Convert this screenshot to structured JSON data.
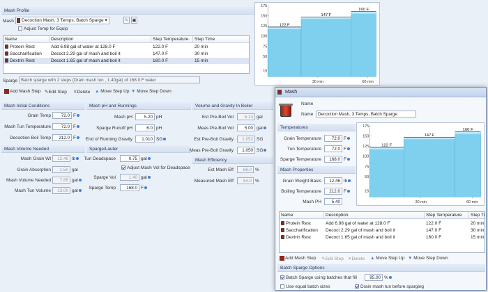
{
  "profile": {
    "section_title": "Mash Profile",
    "mash_label": "Mash",
    "mash_value": "Decoction Mash, 3 Temps, Batch Sparge",
    "adjust_temp_label": "Adjust Temp for Equip",
    "table_headers": [
      "Name",
      "Description",
      "Step Temperature",
      "Step Time"
    ],
    "rows": [
      {
        "name": "Protein Rest",
        "description": "Add 6.98 gal of water at 128.0 F",
        "temp": "122.0 F",
        "time": "20 min"
      },
      {
        "name": "Saccharification",
        "description": "Decoct 2.29 gal of mash and boil it",
        "temp": "147.0 F",
        "time": "30 min"
      },
      {
        "name": "Dextrin Rest",
        "description": "Decoct 1.65 gal of mash and boil it",
        "temp": "160.0 F",
        "time": "15 min"
      }
    ],
    "sparge_label": "Sparge",
    "sparge_value": "Batch sparge with 2 steps (Drain mash tun , 1.40gal) of 168.0 F water",
    "toolbar": {
      "add": "Add Mash Step",
      "edit": "Edit Step",
      "delete": "Delete",
      "up": "Move Step Up",
      "down": "Move Step Down"
    }
  },
  "initial": {
    "title": "Mash Initial Conditions",
    "grain_temp_label": "Grain Temp",
    "grain_temp": "72.0",
    "tun_temp_label": "Mash Tun Temperature",
    "tun_temp": "72.0",
    "boil_temp_label": "Decoction Boil Temp",
    "boil_temp": "212.0",
    "unit_f": "F"
  },
  "vol_needed": {
    "title": "Mash Volume Needed",
    "grain_wt_label": "Mash Grain Wt",
    "grain_wt": "12.46",
    "unit_lb": "lb",
    "absorb_label": "Grain Absorption",
    "absorb": "1.50",
    "unit_gal": "gal",
    "mash_vol_label": "Mash Volume Needed",
    "mash_vol": "7.85",
    "tun_vol_label": "Mash Tun Volume",
    "tun_vol": "13.00"
  },
  "ph": {
    "title": "Mash pH and Runnings",
    "mash_ph_label": "Mash pH",
    "mash_ph": "5.20",
    "unit_ph": "pH",
    "runoff_label": "Sparge Runoff pH",
    "runoff": "6.0",
    "gravity_label": "End of Running Gravity",
    "gravity": "1.010",
    "unit_sg": "SG"
  },
  "lauter": {
    "title": "Sparge/Lauter",
    "deadspace_label": "Tun Deadspace",
    "deadspace": "0.75",
    "unit_gal": "gal",
    "adjust_label": "Adjust Mash Vol for Deadspace",
    "sparge_vol_label": "Sparge Vol",
    "sparge_vol": "1.40",
    "sparge_temp_label": "Sparge Temp",
    "sparge_temp": "168.0",
    "unit_f": "F"
  },
  "boiler": {
    "title": "Volume and Gravity In Boiler",
    "est_vol_label": "Est Pre-Boil Vol",
    "est_vol": "6.13",
    "meas_vol_label": "Meas Pre-Boil Vol",
    "meas_vol": "5.00",
    "unit_gal": "gal",
    "est_grav_label": "Est Pre-Boil Gravity",
    "est_grav": "1.052",
    "meas_grav_label": "Meas Pre-Boil Gravity",
    "meas_grav": "1.050",
    "unit_sg": "SG"
  },
  "eff": {
    "title": "Mash Efficiency",
    "est_label": "Est Mash Eff",
    "est": "68.0",
    "meas_label": "Measured Mash Eff",
    "meas": "54.0",
    "unit": "%"
  },
  "chart_data": [
    {
      "type": "area",
      "y_ticks": [
        "15",
        "50",
        "75",
        "100",
        "125",
        "150",
        "175"
      ],
      "x_ticks": [
        "30 min",
        "60 min"
      ],
      "steps": [
        {
          "label": "122 F",
          "temp": 122,
          "start": 0,
          "end": 20
        },
        {
          "label": "147 F",
          "temp": 147,
          "start": 20,
          "end": 50
        },
        {
          "label": "160 F",
          "temp": 160,
          "start": 50,
          "end": 65
        }
      ]
    },
    {
      "type": "area",
      "y_ticks": [
        "15",
        "50",
        "75",
        "100",
        "125",
        "150",
        "175"
      ],
      "x_ticks": [
        "30 min",
        "60 min"
      ],
      "steps": [
        {
          "label": "122 F",
          "temp": 122,
          "start": 0,
          "end": 20
        },
        {
          "label": "147 F",
          "temp": 147,
          "start": 20,
          "end": 50
        },
        {
          "label": "160 F",
          "temp": 160,
          "start": 50,
          "end": 65
        }
      ]
    }
  ],
  "dialog": {
    "title": "Mash",
    "name_section": "Name",
    "name_label": "Name",
    "name_value": "Decoction Mash, 3 Temps, Batch Sparge",
    "temps_title": "Temperatures",
    "grain_temp_label": "Grain Temperature",
    "grain_temp": "72.0",
    "tun_temp_label": "Tun Temperature",
    "tun_temp": "72.0",
    "sparge_temp_label": "Sparge Temperature",
    "sparge_temp": "168.0",
    "unit_f": "F",
    "props_title": "Mash Properties",
    "grain_wt_label": "Grain Weight Basis",
    "grain_wt": "12.46",
    "unit_lb": "lb",
    "boil_temp_label": "Boiling Temperature",
    "boil_temp": "212.0",
    "ph_label": "Mash PH",
    "ph": "5.40",
    "table_headers": [
      "Name",
      "Description",
      "Step Temperature",
      "Step Tin"
    ],
    "rows": [
      {
        "name": "Protein Rest",
        "description": "Add 6.98 gal of water at 128.0 F",
        "temp": "122.0 F",
        "time": "20 min"
      },
      {
        "name": "Saccharification",
        "description": "Decoct 2.29 gal of mash and boil it",
        "temp": "147.0 F",
        "time": "30 min"
      },
      {
        "name": "Dextrin Rest",
        "description": "Decoct 1.65 gal of mash and boil it",
        "temp": "160.0 F",
        "time": "15 min"
      }
    ],
    "toolbar": {
      "add": "Add Mash Step",
      "edit": "Edit Step",
      "delete": "Delete",
      "up": "Move Step Up",
      "down": "Move Step Down"
    },
    "batch_title": "Batch Sparge Options",
    "batch_fill_label": "Batch Sparge using batches that fill",
    "batch_fill": "95.00",
    "unit_pct": "%",
    "equal_label": "Use equal batch sizes",
    "drain_label": "Drain mash tun before sparging"
  },
  "colors": {
    "area": "#7fd0ee",
    "area_top": "#bfe8f7",
    "accent": "#3f7fd8"
  }
}
